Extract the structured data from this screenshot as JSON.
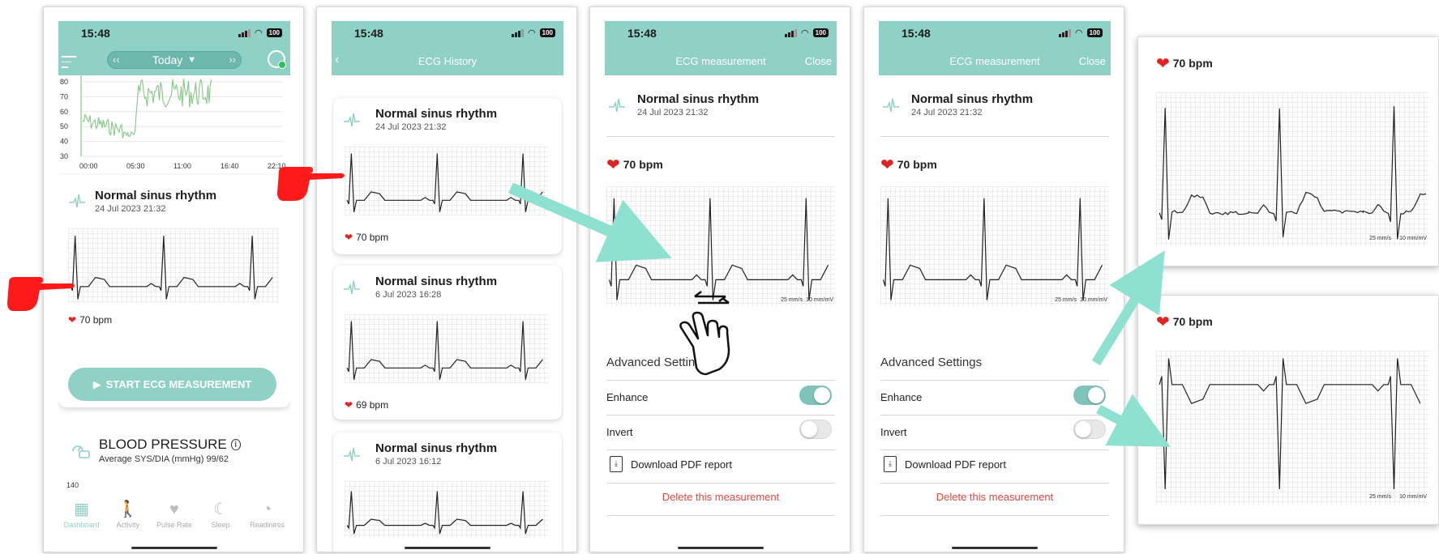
{
  "colors": {
    "accent": "#8fd0c7",
    "heart": "#e02424",
    "delete": "#e0473f",
    "arrow": "#8ee0d1",
    "hand": "#ff1a1a"
  },
  "status": {
    "time": "15:48",
    "battery": "100"
  },
  "dashboard": {
    "date_selector": "Today",
    "hr_chart": {
      "type": "line",
      "y_ticks": [
        "80",
        "70",
        "60",
        "50",
        "40",
        "30"
      ],
      "x_ticks": [
        "00:00",
        "05:30",
        "11:00",
        "16:40",
        "22:10"
      ]
    },
    "ecg_card": {
      "title": "Normal sinus rhythm",
      "date": "24 Jul 2023 21:32",
      "bpm": "70 bpm"
    },
    "start_button": "START ECG MEASUREMENT",
    "bp": {
      "title": "BLOOD PRESSURE",
      "subtitle": "Average SYS/DIA (mmHg) 99/62",
      "axis": "140"
    },
    "tabs": [
      {
        "label": "Dashboard",
        "icon": "dashboard-icon"
      },
      {
        "label": "Activity",
        "icon": "activity-icon"
      },
      {
        "label": "Pulse Rate",
        "icon": "pulse-icon"
      },
      {
        "label": "Sleep",
        "icon": "moon-icon"
      },
      {
        "label": "Readiness",
        "icon": "gauge-icon"
      }
    ]
  },
  "history": {
    "title": "ECG History",
    "records": [
      {
        "title": "Normal sinus rhythm",
        "date": "24 Jul 2023 21:32",
        "bpm": "70 bpm"
      },
      {
        "title": "Normal sinus rhythm",
        "date": "6 Jul 2023 16:28",
        "bpm": "69 bpm"
      },
      {
        "title": "Normal sinus rhythm",
        "date": "6 Jul 2023 16:12"
      }
    ]
  },
  "measurement": {
    "title": "ECG measurement",
    "close": "Close",
    "record_title": "Normal sinus rhythm",
    "record_date": "24 Jul 2023 21:32",
    "bpm": "70 bpm",
    "speed": "25 mm/s",
    "gain": "10 mm/mV",
    "advanced": "Advanced Settings",
    "enhance": "Enhance",
    "invert": "Invert",
    "download": "Download PDF report",
    "delete": "Delete this measurement",
    "screen3": {
      "enhance_on": true,
      "invert_on": false
    },
    "screen4": {
      "enhance_on": true,
      "invert_on": false
    }
  },
  "zoom": {
    "bpm": "70 bpm",
    "speed": "25 mm/s",
    "gain": "10 mm/mV"
  }
}
